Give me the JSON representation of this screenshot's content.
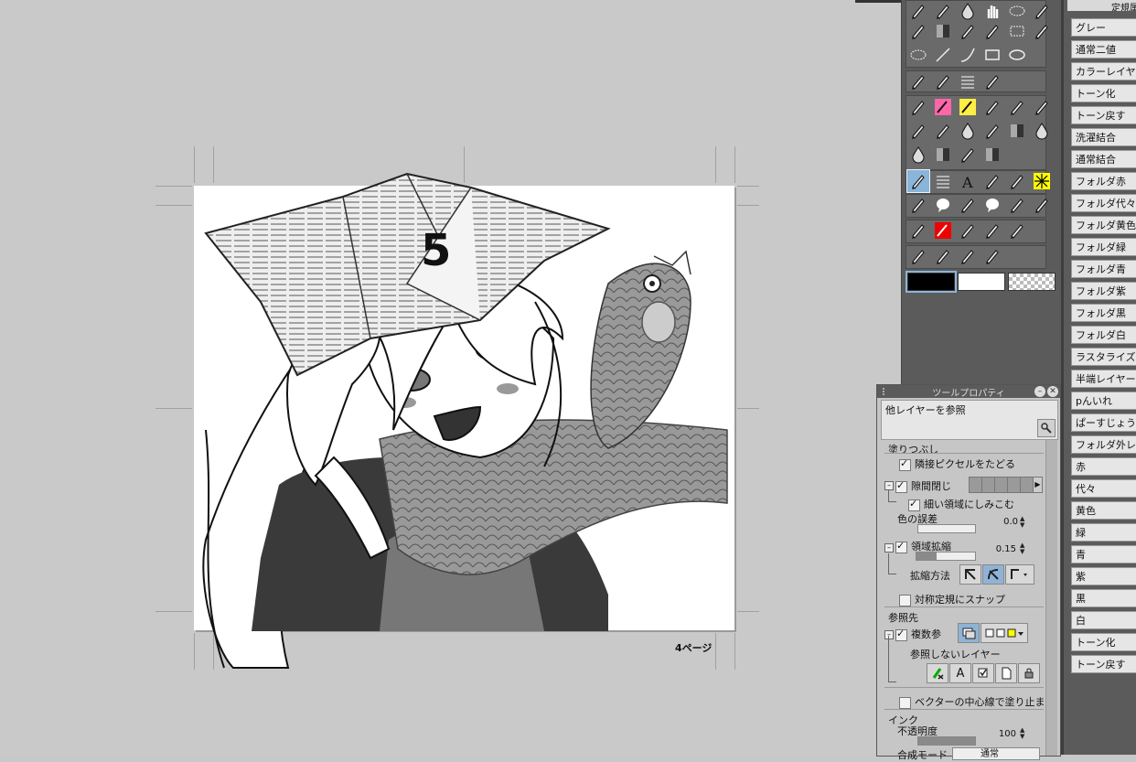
{
  "canvas": {
    "page_label": "4ページ"
  },
  "colors": {
    "main": "#000000",
    "sub": "#ffffff",
    "transparent": "checker",
    "accent": "#8ab4d8"
  },
  "tool_palette": {
    "tools": [
      "lasso-select-icon",
      "magnifier-icon",
      "eyedropper-icon",
      "hand-icon",
      "ellipse-select-icon",
      "magic-wand-icon",
      "pen-icon",
      "gradient-icon",
      "pen-nib-icon",
      "move-layer-icon",
      "rect-select-icon",
      "object-select-icon",
      "ellipse-icon",
      "line-icon",
      "curve-icon",
      "rectangle-icon",
      "oval-icon",
      "blend-icon",
      "pencil-brush-icon",
      "hatch-icon",
      "fill-icon",
      "g-pen-icon",
      "color-pen-icon",
      "marker-icon",
      "brush-icon",
      "eraser-icon",
      "soft-eraser-icon",
      "stamp-icon",
      "airbrush-icon",
      "drop-icon",
      "ruler-icon",
      "gradient-icon",
      "drop-icon",
      "drop-icon",
      "gradient-icon",
      "figure-icon",
      "gradient-icon",
      "fill-bucket-icon",
      "hatch-icon",
      "text-icon",
      "effect-icon",
      "arrow-icon",
      "burst-icon",
      "frame-icon",
      "balloon-icon",
      "pen-icon",
      "balloon-icon",
      "tail-icon",
      "tail-icon",
      "correct-line-icon",
      "red-pen-icon",
      "correct-line-icon",
      "correct-line-icon",
      "correct-line-icon",
      "ruler-tool-icon",
      "perspective-icon",
      "symmetry-icon",
      "pen-icon"
    ]
  },
  "tool_property": {
    "title": "ツールプロパティ",
    "sub_tool_name": "他レイヤーを参照",
    "section_fill": "塗りつぶし",
    "follow_adjacent": "隣接ピクセルをたどる",
    "close_gap": "隙間閉じ",
    "fill_narrow": "細い領域にしみこむ",
    "color_margin_label": "色の誤差",
    "color_margin_value": "0.0",
    "area_scaling": "領域拡縮",
    "area_scaling_value": "0.15",
    "scaling_method": "拡縮方法",
    "snap_symmetry": "対称定規にスナップ",
    "section_reference": "参照先",
    "multiple_ref": "複数参",
    "exclude_layers": "参照しないレイヤー",
    "vector_center": "ベクターの中心線で塗り止ま",
    "section_ink": "インク",
    "opacity_label": "不透明度",
    "opacity_value": "100",
    "blend_mode_label": "合成モード",
    "blend_mode_value": "通常",
    "scale_values": {
      "color_margin": 0.0,
      "area_scaling": 0.35,
      "opacity": 1.0
    }
  },
  "auto_actions": {
    "header": "定規属",
    "items": [
      "グレー",
      "通常二値",
      "カラーレイヤー",
      "トーン化",
      "トーン戻す",
      "洗濯結合",
      "通常結合",
      "フォルダ赤",
      "フォルダ代々",
      "フォルダ黄色",
      "フォルダ緑",
      "フォルダ青",
      "フォルダ紫",
      "フォルダ黒",
      "フォルダ白",
      "ラスタライズ",
      "半端レイヤーを",
      "pんいれ",
      "ぱーすじょうぎ",
      "フォルダ外レイヤ",
      "赤",
      "代々",
      "黄色",
      "緑",
      "青",
      "紫",
      "黒",
      "白",
      "トーン化",
      "トーン戻す"
    ]
  }
}
